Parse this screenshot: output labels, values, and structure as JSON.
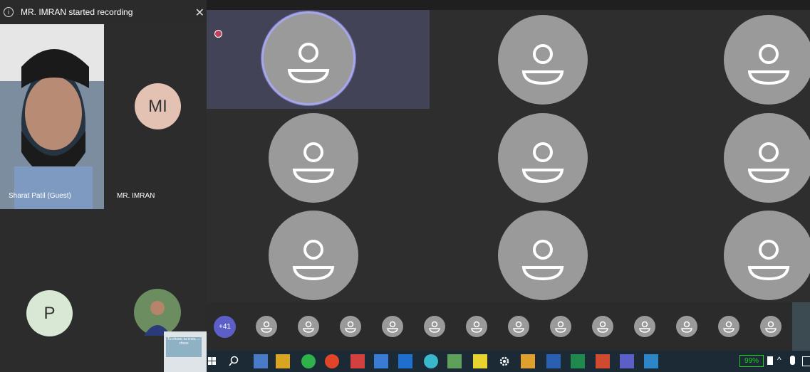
{
  "notification": {
    "text": "MR. IMRAN started recording"
  },
  "participants": {
    "sharat": {
      "name": "Sharat Patil (Guest)"
    },
    "imran": {
      "initials": "MI",
      "name": "MR. IMRAN"
    },
    "p": {
      "initials": "P"
    },
    "photo_card_text": "Tu chose, tu crois, ... chose"
  },
  "strip": {
    "overflow_count": "+41"
  },
  "taskbar": {
    "battery": "99%"
  },
  "colors": {
    "accent": "#5b5fc7",
    "active_ring": "#a6a7e6",
    "battery_green": "#1fd21f"
  }
}
